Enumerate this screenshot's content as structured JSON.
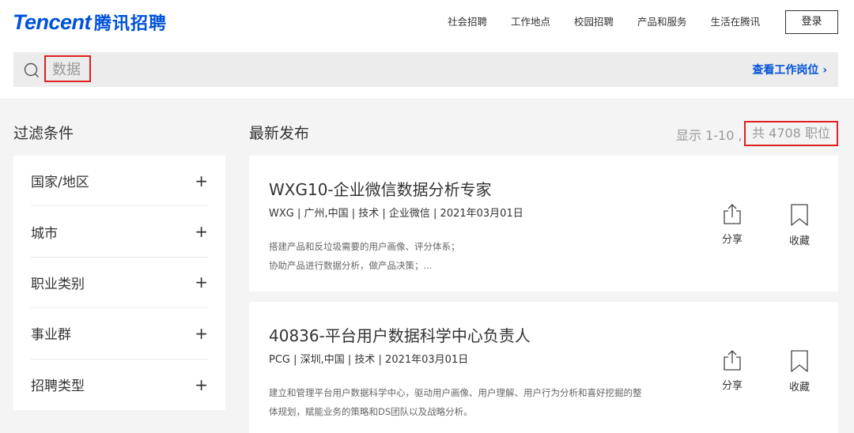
{
  "brand": {
    "logo_en": "Tencent",
    "logo_cn": "腾讯招聘",
    "color": "#0052d9"
  },
  "nav": {
    "items": [
      "社会招聘",
      "工作地点",
      "校园招聘",
      "产品和服务",
      "生活在腾讯"
    ],
    "login_label": "登录"
  },
  "search": {
    "value": "数据",
    "view_jobs_label": "查看工作岗位 ›"
  },
  "filters": {
    "title": "过滤条件",
    "items": [
      "国家/地区",
      "城市",
      "职业类别",
      "事业群",
      "招聘类型"
    ],
    "expand_symbol": "+"
  },
  "results": {
    "title": "最新发布",
    "range_text": "显示 1-10 ,",
    "total_text": "共 4708 职位"
  },
  "jobs": [
    {
      "title": "WXG10-企业微信数据分析专家",
      "meta": "WXG | 广州,中国 | 技术 | 企业微信 | 2021年03月01日",
      "desc": [
        "搭建产品和反垃圾需要的用户画像、评分体系；",
        "协助产品进行数据分析，做产品决策；..."
      ]
    },
    {
      "title": "40836-平台用户数据科学中心负责人",
      "meta": "PCG | 深圳,中国 | 技术 | 2021年03月01日",
      "desc": [
        "建立和管理平台用户数据科学中心，驱动用户画像、用户理解、用户行为分析和喜好挖掘的整",
        "体规划，赋能业务的策略和DS团队以及战略分析。"
      ]
    }
  ],
  "actions": {
    "share_label": "分享",
    "favorite_label": "收藏"
  },
  "icons": {
    "search": "search-icon",
    "share": "share-icon",
    "favorite": "bookmark-icon",
    "chevron": "chevron-right-icon"
  },
  "colors": {
    "highlight_border": "#e02020",
    "search_bg": "#ececec",
    "page_bg": "#f4f4f4"
  }
}
